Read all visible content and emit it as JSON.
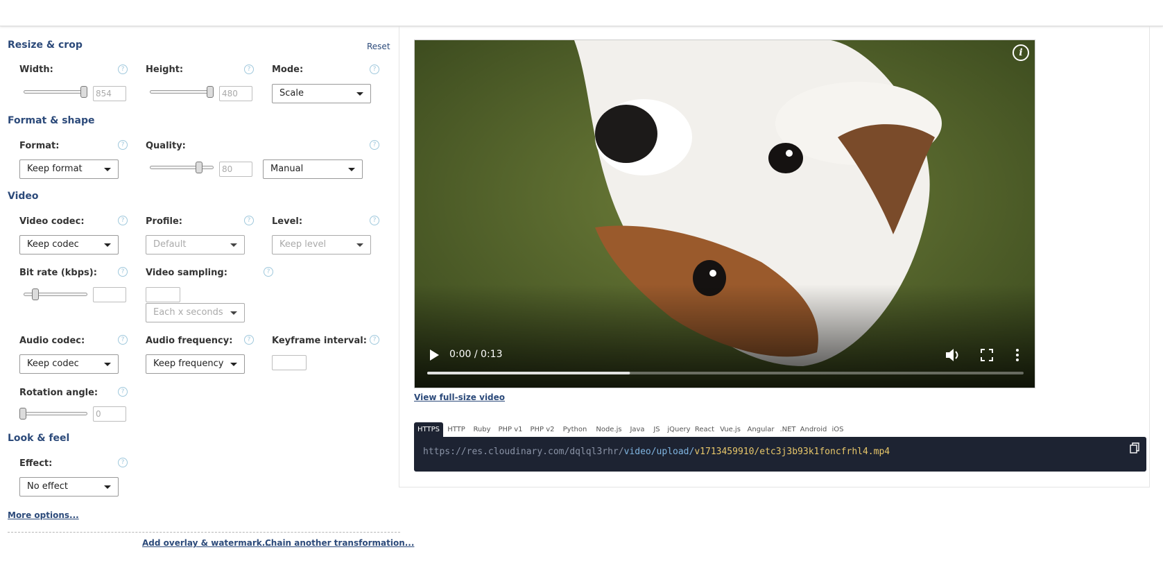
{
  "sections": {
    "resize": "Resize & crop",
    "format": "Format & shape",
    "video": "Video",
    "look": "Look & feel"
  },
  "reset_label": "Reset",
  "fields": {
    "width_label": "Width:",
    "width_value": "854",
    "height_label": "Height:",
    "height_value": "480",
    "mode_label": "Mode:",
    "mode_value": "Scale",
    "format_label": "Format:",
    "format_value": "Keep format",
    "quality_label": "Quality:",
    "quality_value": "80",
    "quality_mode": "Manual",
    "video_codec_label": "Video codec:",
    "video_codec_value": "Keep codec",
    "profile_label": "Profile:",
    "profile_value": "Default",
    "level_label": "Level:",
    "level_value": "Keep level",
    "bitrate_label": "Bit rate (kbps):",
    "sampling_label": "Video sampling:",
    "sampling_value": "Each x seconds",
    "audio_codec_label": "Audio codec:",
    "audio_codec_value": "Keep codec",
    "audio_freq_label": "Audio frequency:",
    "audio_freq_value": "Keep frequency",
    "keyframe_label": "Keyframe interval:",
    "rotation_label": "Rotation angle:",
    "rotation_value": "0",
    "effect_label": "Effect:",
    "effect_value": "No effect"
  },
  "sliders": {
    "width": 1.0,
    "height": 1.0,
    "quality": 0.8,
    "bitrate": 0.15,
    "rotation": 0.0
  },
  "links": {
    "more_options": "More options...",
    "add_overlay": "Add overlay & watermark...",
    "chain": "Chain another transformation...",
    "view_full": "View full-size video"
  },
  "player": {
    "time": "0:00 / 0:13",
    "progress": 0.34
  },
  "tabs": [
    "HTTPS",
    "HTTP",
    "Ruby",
    "PHP v1",
    "PHP v2",
    "Python",
    "Node.js",
    "Java",
    "JS",
    "jQuery",
    "React",
    "Vue.js",
    "Angular",
    ".NET",
    "Android",
    "iOS"
  ],
  "url": {
    "base": "https://res.cloudinary.com/dqlql3rhr/",
    "path": "video/upload/",
    "file": "v1713459910/etc3j3b93k1foncfrhl4.mp4"
  },
  "icons": {
    "help": "help-icon",
    "info": "info-icon",
    "play": "play-icon",
    "volume": "volume-icon",
    "fullscreen": "fullscreen-icon",
    "menu": "more-vert-icon",
    "copy": "copy-icon"
  },
  "help_glyph": "?",
  "info_glyph": "i"
}
